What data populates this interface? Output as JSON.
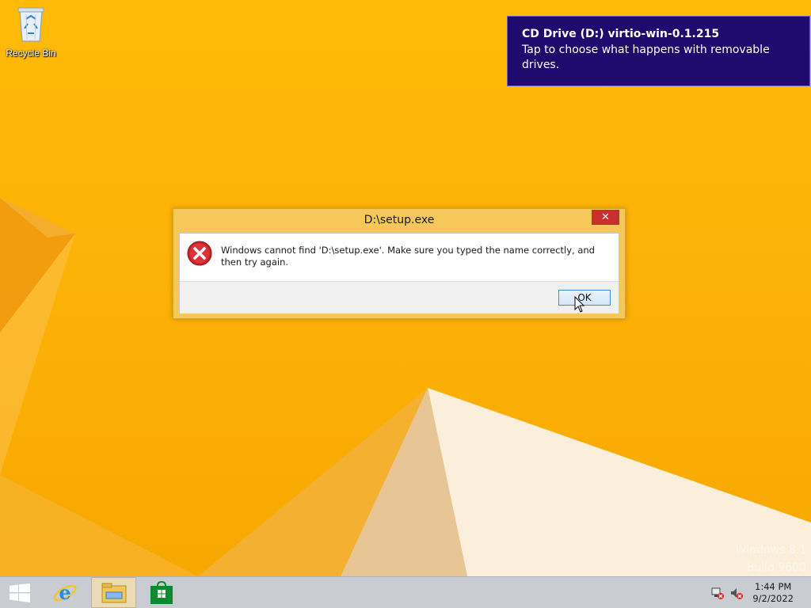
{
  "desktop": {
    "recycle_bin_label": "Recycle Bin"
  },
  "toast": {
    "title": "CD Drive (D:) virtio-win-0.1.215",
    "body": "Tap to choose what happens with removable drives."
  },
  "dialog": {
    "title": "D:\\setup.exe",
    "close_label": "✕",
    "message": "Windows cannot find 'D:\\setup.exe'. Make sure you typed the name correctly, and then try again.",
    "ok_label": "OK",
    "icon": "error-icon"
  },
  "watermark": {
    "line1": "Windows 8.1",
    "line2": "Build 9600"
  },
  "taskbar": {
    "items": [
      "start-icon",
      "internet-explorer-icon",
      "file-explorer-icon",
      "store-icon"
    ],
    "active_item": "file-explorer-icon",
    "tray_icons": [
      "network-icon",
      "volume-muted-icon"
    ],
    "time": "1:44 PM",
    "date": "9/2/2022"
  },
  "colors": {
    "wallpaper": "#fdb207",
    "toast_bg": "#1f0b6e",
    "dialog_frame": "#f6c85a",
    "close_button": "#c7302c",
    "taskbar": "#c9cdd2"
  }
}
